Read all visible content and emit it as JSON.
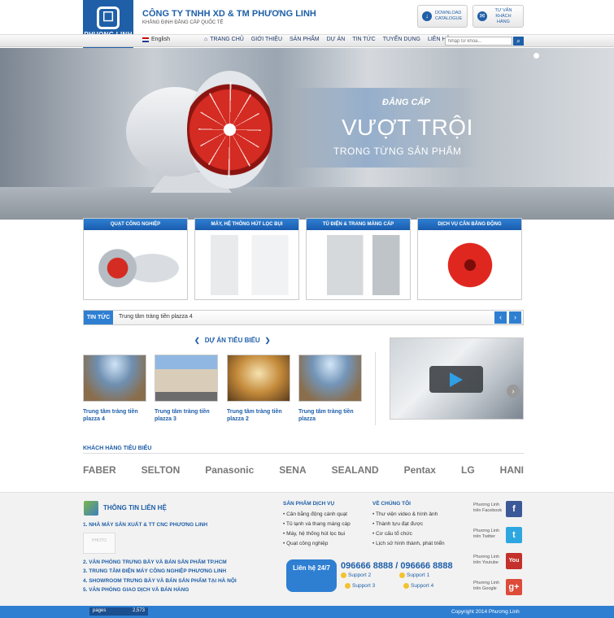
{
  "brand": {
    "logo_line1": "PHUONG LINH",
    "logo_line2": "FANS & BLOWERS",
    "company": "CÔNG TY TNHH XD & TM PHƯƠNG LINH",
    "slogan": "KHẲNG ĐỊNH ĐẲNG CẤP QUỐC TẾ"
  },
  "header_buttons": {
    "download": "DOWNLOAD CATALOGUE",
    "support": "TƯ VẤN KHÁCH HÀNG"
  },
  "nav": {
    "lang": "English",
    "items": [
      "TRANG CHỦ",
      "GIỚI THIỆU",
      "SẢN PHẨM",
      "DỰ ÁN",
      "TIN TỨC",
      "TUYỂN DỤNG",
      "LIÊN HỆ"
    ],
    "search_placeholder": "Nhập từ khóa..."
  },
  "banner": {
    "line1": "ĐẲNG CẤP",
    "line2": "VƯỢT TRỘI",
    "line3": "TRONG TỪNG SẢN PHẨM"
  },
  "categories": [
    "QUẠT CÔNG NGHIỆP",
    "MÁY, HỆ THỐNG HÚT LỌC BỤI",
    "TỦ ĐIỆN & TRANG MÁNG CÁP",
    "DỊCH VỤ CÂN BẰNG ĐỘNG"
  ],
  "ticker": {
    "label": "TIN TỨC",
    "text": "Trung tâm tràng tiền plazza 4"
  },
  "projects": {
    "title": "DỰ ÁN TIÊU BIỂU",
    "items": [
      "Trung tâm tràng tiền plazza 4",
      "Trung tâm tràng tiền plazza 3",
      "Trung tâm tràng tiền plazza 2",
      "Trung tâm tràng tiền plazza"
    ]
  },
  "partners": {
    "title": "KHÁCH HÀNG TIÊU BIỂU",
    "items": [
      "FABER",
      "SELTON",
      "Panasonic",
      "SENA",
      "SEALAND",
      "Pentax",
      "LG",
      "HANI"
    ]
  },
  "contact": {
    "title": "THÔNG TIN LIÊN HỆ",
    "items": [
      "1. NHÀ MÁY SẢN XUẤT & TT CNC PHƯƠNG LINH",
      "2. VĂN PHÒNG TRƯNG BÀY VÀ BÁN SẢN PHẨM TP.HCM",
      "3. TRUNG TÂM ĐIỆN MÁY CÔNG NGHIỆP PHƯƠNG LINH",
      "4. SHOWROOM TRƯNG BÀY VÀ BÁN SẢN PHẨM TẠI HÀ NỘI",
      "5. VĂN PHÒNG GIAO DỊCH VÀ BÁN HÀNG"
    ],
    "photo": "PHOTO"
  },
  "services": {
    "title": "SẢN PHẨM DỊCH VỤ",
    "items": [
      "Cân bằng động cánh quạt",
      "Tủ lạnh và thang máng cáp",
      "Máy, hệ thống hút lọc bụi",
      "Quạt công nghiệp"
    ]
  },
  "about": {
    "title": "VỀ CHÚNG TÔI",
    "items": [
      "Thư viện video & hình ảnh",
      "Thành tựu đạt được",
      "Cơ cấu tổ chức",
      "Lịch sử hình thành, phát triển"
    ]
  },
  "hotline": {
    "icon_label": "Liên hệ 24/7",
    "numbers": "096666 8888 / 096666 8888",
    "supports": [
      "Support 2",
      "Support 1",
      "Support 3",
      "Support 4"
    ]
  },
  "social": [
    {
      "text": "Phương Linh trên Facebook",
      "icon": "f",
      "color": "#3b5998"
    },
    {
      "text": "Phương Linh trên Twitter",
      "icon": "t",
      "color": "#2ea7e0"
    },
    {
      "text": "Phương Linh trên Youtube",
      "icon": "You",
      "color": "#c4302b"
    },
    {
      "text": "Phương Linh trên Google",
      "icon": "g+",
      "color": "#dd4b39"
    }
  ],
  "footer": {
    "counter_label": "pages",
    "counter_value": "2,573",
    "copyright": "Copyright 2014 Phương Linh"
  }
}
